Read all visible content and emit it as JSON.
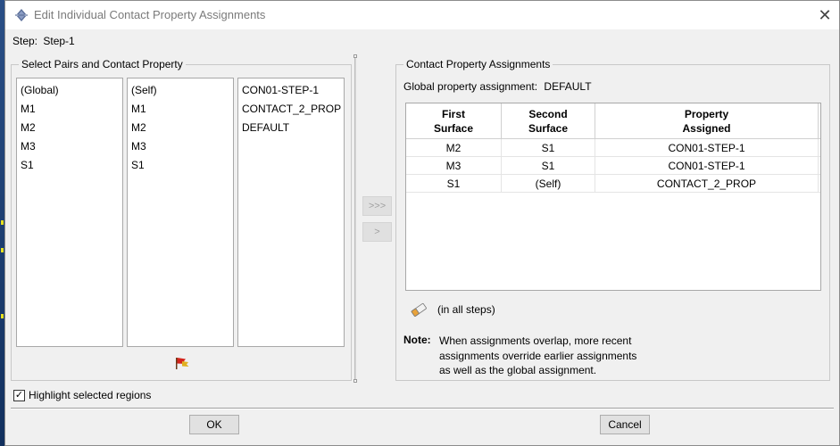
{
  "window": {
    "title": "Edit Individual Contact Property Assignments",
    "close_glyph": "✕"
  },
  "step": {
    "label": "Step:",
    "value": "Step-1"
  },
  "left_panel": {
    "title": "Select Pairs and Contact Property",
    "first_surfaces": [
      "(Global)",
      "M1",
      "M2",
      "M3",
      "S1"
    ],
    "second_surfaces": [
      "(Self)",
      "M1",
      "M2",
      "M3",
      "S1"
    ],
    "properties": [
      "CON01-STEP-1",
      "CONTACT_2_PROP",
      "DEFAULT"
    ]
  },
  "transfer": {
    "add_all_label": ">>>",
    "add_label": ">"
  },
  "right_panel": {
    "title": "Contact Property Assignments",
    "global_label": "Global property assignment:",
    "global_value": "DEFAULT",
    "table": {
      "headers": [
        {
          "line1": "First",
          "line2": "Surface"
        },
        {
          "line1": "Second",
          "line2": "Surface"
        },
        {
          "line1": "Property",
          "line2": "Assigned"
        }
      ],
      "rows": [
        [
          "M2",
          "S1",
          "CON01-STEP-1"
        ],
        [
          "M3",
          "S1",
          "CON01-STEP-1"
        ],
        [
          "S1",
          "(Self)",
          "CONTACT_2_PROP"
        ]
      ]
    },
    "eraser_text": "(in all steps)",
    "note_label": "Note:",
    "note_lines": [
      "When assignments overlap, more recent",
      "assignments override earlier assignments",
      "as well as the global assignment."
    ]
  },
  "highlight": {
    "label": "Highlight selected regions",
    "checked": true,
    "check_glyph": "✓"
  },
  "buttons": {
    "ok": "OK",
    "cancel": "Cancel"
  },
  "icons": {
    "title": "abaqus-logo-icon",
    "flag": "flag-icon",
    "eraser": "eraser-icon"
  },
  "colors": {
    "dialog_bg": "#f0f0f0",
    "titlebar_bg": "#ffffff",
    "list_bg": "#ffffff",
    "border": "#a8a8a8"
  }
}
